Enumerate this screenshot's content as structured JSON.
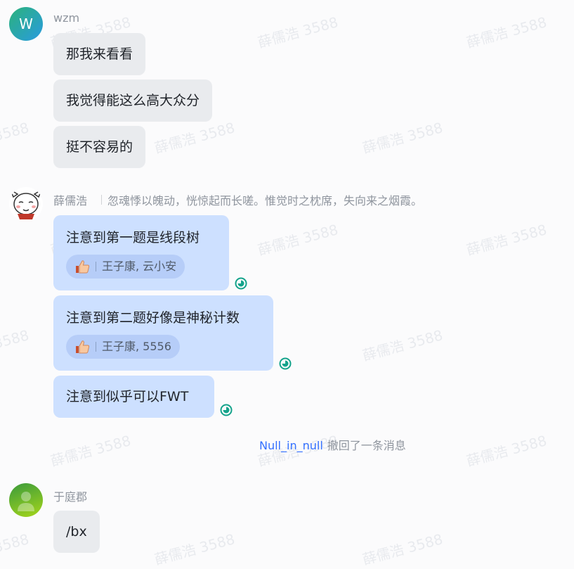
{
  "watermark": "薛儒浩 3588",
  "colors": {
    "bubble_self": "#cde0ff",
    "bubble_other": "#e9ebee",
    "read_icon": "#14a38b",
    "recall_user": "#3370ff"
  },
  "messages": [
    {
      "sender": "wzm",
      "avatar_letter": "W",
      "bubbles": [
        "那我来看看",
        "我觉得能这么高大众分",
        "挺不容易的"
      ]
    },
    {
      "sender": "薛儒浩",
      "signature": "忽魂悸以魄动，恍惊起而长嗟。惟觉时之枕席，失向来之烟霞。",
      "bubbles": [
        {
          "text": "注意到第一题是线段树",
          "reaction": {
            "icon": "thumbs-up-icon",
            "users": "王子康, 云小安"
          }
        },
        {
          "text": "注意到第二题好像是神秘计数",
          "reaction": {
            "icon": "thumbs-up-icon",
            "users": "王子康, 5556"
          }
        },
        {
          "text": "注意到似乎可以FWT"
        }
      ]
    },
    {
      "recall": {
        "user": "Null_in_null",
        "text": "撤回了一条消息"
      }
    },
    {
      "sender": "于庭郡",
      "bubbles": [
        "/bx"
      ]
    }
  ]
}
